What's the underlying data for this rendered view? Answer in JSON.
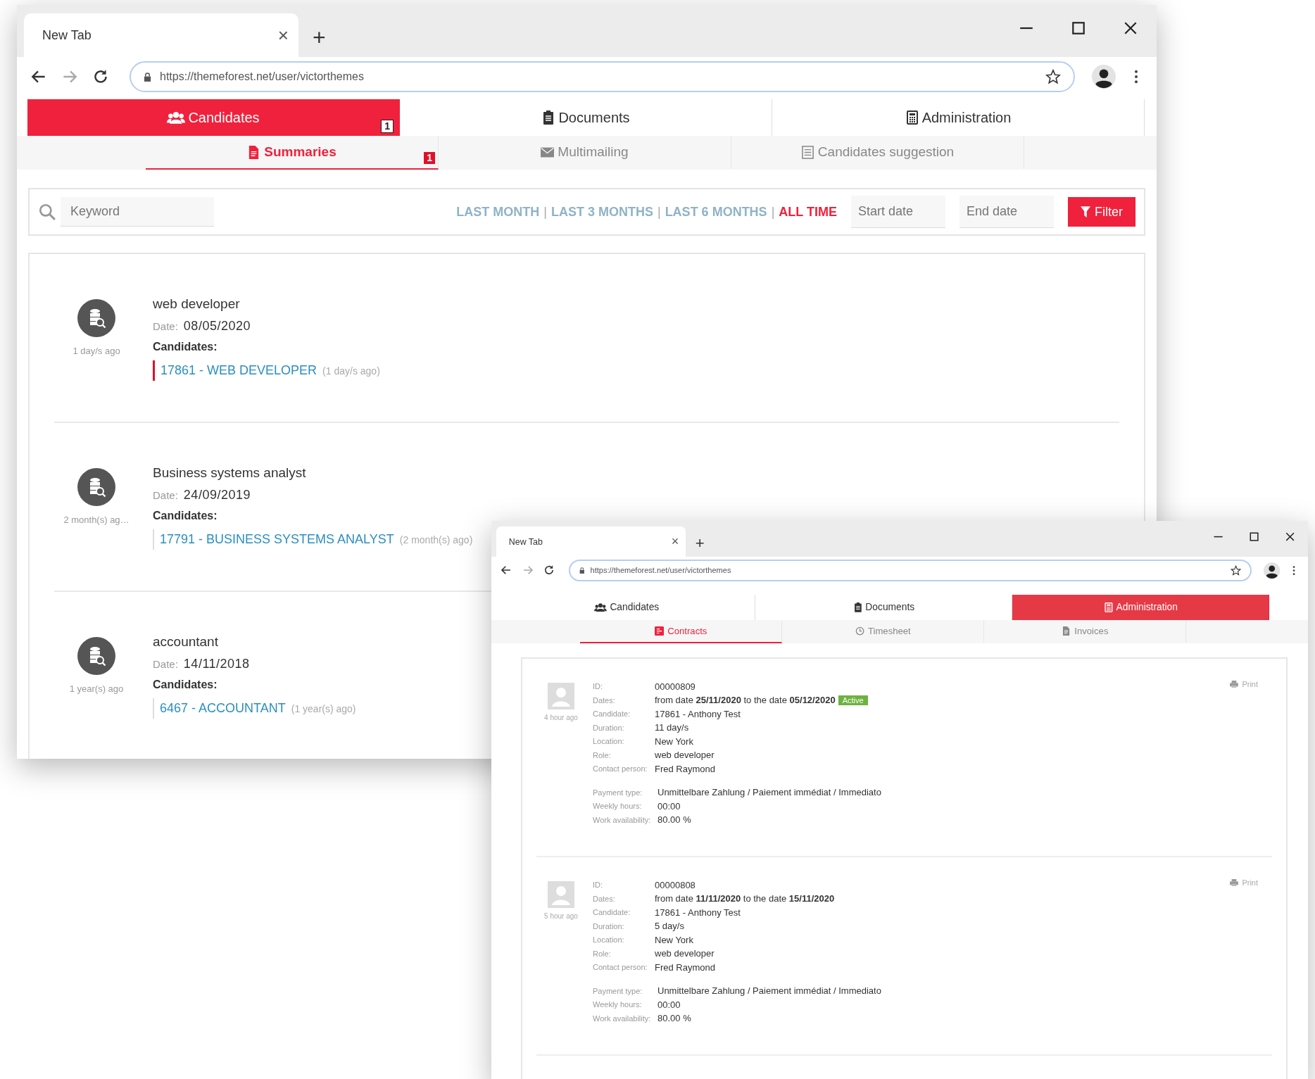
{
  "windows": [
    {
      "kind": "summaries",
      "tab_title": "New Tab",
      "tab_close": "×",
      "new_tab": "+",
      "url": "https://themeforest.net/user/victorthemes",
      "main_tabs": [
        {
          "label": "Candidates",
          "selected": true,
          "badge": "1"
        },
        {
          "label": "Documents",
          "selected": false
        },
        {
          "label": "Administration",
          "selected": false
        }
      ],
      "sub_tabs": [
        {
          "label": "Summaries",
          "selected": true,
          "badge": "1"
        },
        {
          "label": "Multimailing",
          "selected": false
        },
        {
          "label": "Candidates suggestion",
          "selected": false
        }
      ],
      "filter": {
        "keyword_placeholder": "Keyword",
        "periods": [
          {
            "label": "LAST MONTH",
            "selected": false
          },
          {
            "label": "LAST 3 MONTHS",
            "selected": false
          },
          {
            "label": "LAST 6 MONTHS",
            "selected": false
          },
          {
            "label": "ALL TIME",
            "selected": true
          }
        ],
        "separators": [
          "|",
          "|",
          "|"
        ],
        "start_placeholder": "Start date",
        "end_placeholder": "End date",
        "button": "Filter"
      },
      "summaries": [
        {
          "ago": "1 day/s ago",
          "title": "web developer",
          "date_label": "Date:",
          "date": "08/05/2020",
          "candidates_label": "Candidates:",
          "candidates": [
            {
              "link": "17861 - WEB DEVELOPER",
              "ago": "(1 day/s ago)",
              "selected": true
            }
          ]
        },
        {
          "ago": "2 month(s) ag…",
          "title": "Business systems analyst",
          "date_label": "Date:",
          "date": "24/09/2019",
          "candidates_label": "Candidates:",
          "candidates": [
            {
              "link": "17791 - BUSINESS SYSTEMS ANALYST",
              "ago": "(2 month(s) ago)",
              "selected": false
            }
          ]
        },
        {
          "ago": "1 year(s) ago",
          "title": "accountant",
          "date_label": "Date:",
          "date": "14/11/2018",
          "candidates_label": "Candidates:",
          "candidates": [
            {
              "link": "6467 - ACCOUNTANT",
              "ago": "(1 year(s) ago)",
              "selected": false
            }
          ]
        }
      ]
    },
    {
      "kind": "contracts",
      "tab_title": "New Tab",
      "tab_close": "×",
      "new_tab": "+",
      "url": "https://themeforest.net/user/victorthemes",
      "main_tabs": [
        {
          "label": "Candidates",
          "selected": false
        },
        {
          "label": "Documents",
          "selected": false
        },
        {
          "label": "Administration",
          "selected": true
        }
      ],
      "sub_tabs": [
        {
          "label": "Contracts",
          "selected": true
        },
        {
          "label": "Timesheet",
          "selected": false
        },
        {
          "label": "Invoices",
          "selected": false
        }
      ],
      "contracts": [
        {
          "ago": "4 hour ago",
          "print": "Print",
          "fields": [
            {
              "label": "ID:",
              "value": "00000809"
            },
            {
              "label": "Dates:",
              "value": "from date **25/11/2020** to the date **05/12/2020**",
              "status": "Active"
            },
            {
              "label": "Candidate:",
              "value": "17861 - Anthony Test"
            },
            {
              "label": "Duration:",
              "value": "11 day/s"
            },
            {
              "label": "Location:",
              "value": "New York"
            },
            {
              "label": "Role:",
              "value": "web developer"
            },
            {
              "label": "Contact person:",
              "value": "Fred Raymond"
            }
          ],
          "extra_fields": [
            {
              "label": "Payment type:",
              "value": "Unmittelbare Zahlung / Paiement immédiat / Immediato"
            },
            {
              "label": "Weekly hours:",
              "value": "00:00"
            },
            {
              "label": "Work availability:",
              "value": "80.00 %"
            }
          ]
        },
        {
          "ago": "5 hour ago",
          "print": "Print",
          "fields": [
            {
              "label": "ID:",
              "value": "00000808"
            },
            {
              "label": "Dates:",
              "value": "from date **11/11/2020** to the date **15/11/2020**"
            },
            {
              "label": "Candidate:",
              "value": "17861 - Anthony Test"
            },
            {
              "label": "Duration:",
              "value": "5 day/s"
            },
            {
              "label": "Location:",
              "value": "New York"
            },
            {
              "label": "Role:",
              "value": "web developer"
            },
            {
              "label": "Contact person:",
              "value": "Fred Raymond"
            }
          ],
          "extra_fields": [
            {
              "label": "Payment type:",
              "value": "Unmittelbare Zahlung / Paiement immédiat / Immediato"
            },
            {
              "label": "Weekly hours:",
              "value": "00:00"
            },
            {
              "label": "Work availability:",
              "value": "80.00 %"
            }
          ]
        }
      ]
    }
  ]
}
